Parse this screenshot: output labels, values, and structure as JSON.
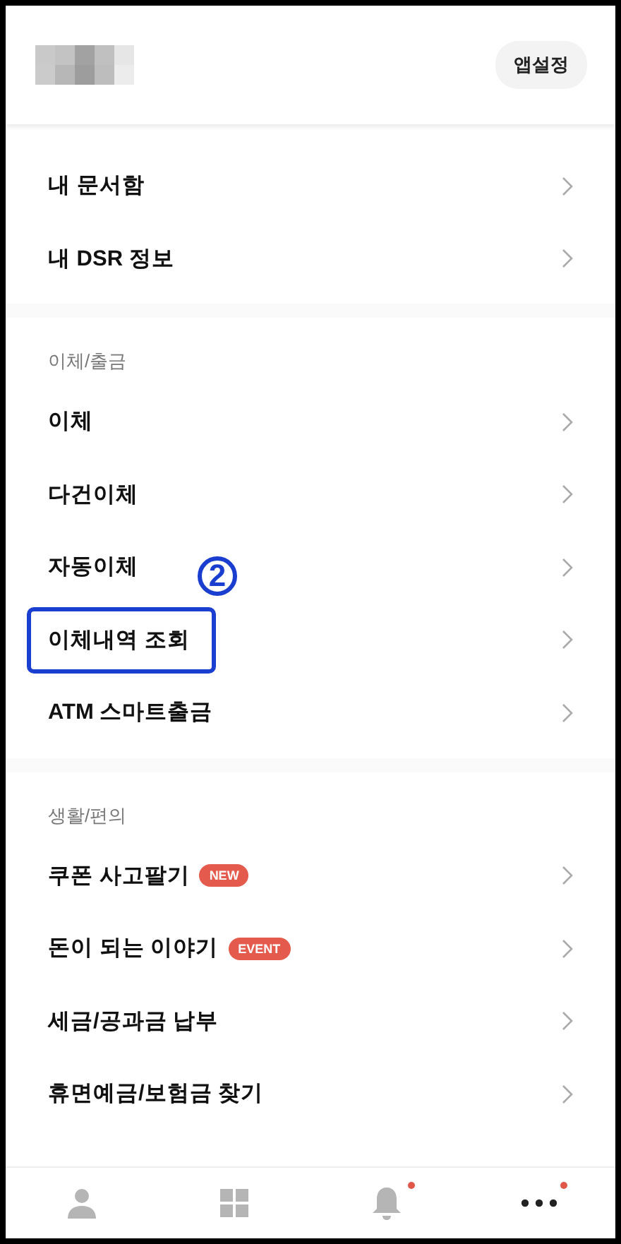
{
  "header": {
    "settings_button": "앱설정"
  },
  "sections": [
    {
      "items": [
        {
          "label": "내 문서함"
        },
        {
          "label": "내 DSR 정보"
        }
      ]
    },
    {
      "heading": "이체/출금",
      "items": [
        {
          "label": "이체"
        },
        {
          "label": "다건이체"
        },
        {
          "label": "자동이체"
        },
        {
          "label": "이체내역 조회",
          "highlighted": true,
          "annotation": "2"
        },
        {
          "label": "ATM 스마트출금"
        }
      ]
    },
    {
      "heading": "생활/편의",
      "items": [
        {
          "label": "쿠폰 사고팔기",
          "badge": "NEW"
        },
        {
          "label": "돈이 되는 이야기",
          "badge": "EVENT"
        },
        {
          "label": "세금/공과금 납부"
        },
        {
          "label": "휴면예금/보험금 찾기"
        }
      ]
    }
  ],
  "bottom_nav": [
    {
      "kind": "person",
      "selected": false,
      "dot": false
    },
    {
      "kind": "grid",
      "selected": false,
      "dot": false
    },
    {
      "kind": "bell",
      "selected": false,
      "dot": true
    },
    {
      "kind": "more",
      "selected": true,
      "dot": true
    }
  ]
}
